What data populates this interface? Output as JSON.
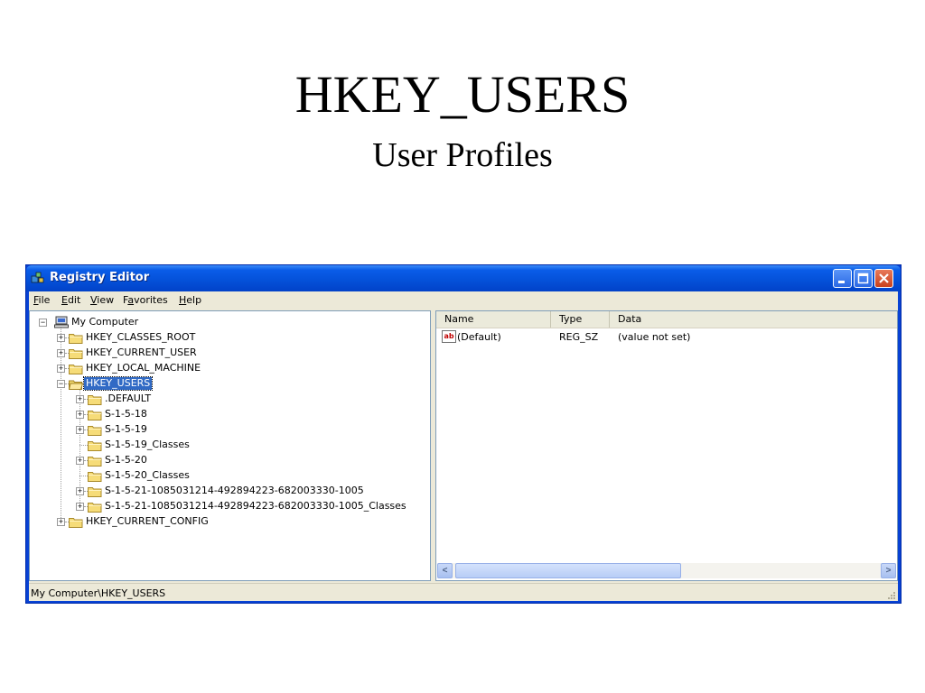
{
  "slide": {
    "title": "HKEY_USERS",
    "subtitle": "User Profiles"
  },
  "window": {
    "title": "Registry Editor",
    "controls": [
      "minimize-icon",
      "maximize-icon",
      "close-icon"
    ]
  },
  "menu": [
    {
      "label": "File",
      "mnemonic": "F",
      "rest": "ile"
    },
    {
      "label": "Edit",
      "mnemonic": "E",
      "rest": "dit"
    },
    {
      "label": "View",
      "mnemonic": "V",
      "rest": "iew"
    },
    {
      "label": "Favorites",
      "pre": "F",
      "mnemonic": "a",
      "rest": "vorites"
    },
    {
      "label": "Help",
      "mnemonic": "H",
      "rest": "elp"
    }
  ],
  "tree": {
    "root": "My Computer",
    "nodes": [
      {
        "label": "HKEY_CLASSES_ROOT",
        "expander": "+"
      },
      {
        "label": "HKEY_CURRENT_USER",
        "expander": "+"
      },
      {
        "label": "HKEY_LOCAL_MACHINE",
        "expander": "+"
      },
      {
        "label": "HKEY_USERS",
        "expander": "-",
        "selected": true
      },
      {
        "label": ".DEFAULT",
        "expander": "+"
      },
      {
        "label": "S-1-5-18",
        "expander": "+"
      },
      {
        "label": "S-1-5-19",
        "expander": "+"
      },
      {
        "label": "S-1-5-19_Classes",
        "expander": ""
      },
      {
        "label": "S-1-5-20",
        "expander": "+"
      },
      {
        "label": "S-1-5-20_Classes",
        "expander": ""
      },
      {
        "label": "S-1-5-21-1085031214-492894223-682003330-1005",
        "expander": "+"
      },
      {
        "label": "S-1-5-21-1085031214-492894223-682003330-1005_Classes",
        "expander": "+"
      },
      {
        "label": "HKEY_CURRENT_CONFIG",
        "expander": "+"
      }
    ]
  },
  "list": {
    "columns": [
      "Name",
      "Type",
      "Data"
    ],
    "rows": [
      {
        "icon": "string-value-icon",
        "icon_text": "ab",
        "name": "(Default)",
        "type": "REG_SZ",
        "data": "(value not set)"
      }
    ]
  },
  "status": "My Computer\\HKEY_USERS",
  "colors": {
    "titlebar": "#0a5ce8",
    "selection": "#316ac5",
    "face": "#ece9d8"
  }
}
